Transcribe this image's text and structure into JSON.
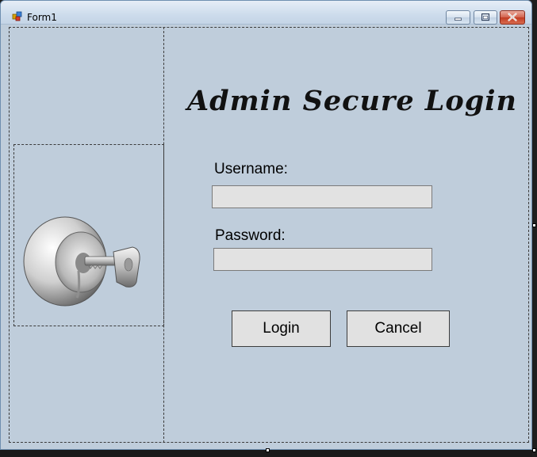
{
  "window": {
    "title": "Form1",
    "icon": "winforms-form-icon",
    "caption_buttons": [
      "minimize-icon",
      "maximize-icon",
      "close-icon"
    ]
  },
  "form": {
    "heading": "Admin Secure Login",
    "username_label": "Username:",
    "username_value": "",
    "password_label": "Password:",
    "password_value": "",
    "login_label": "Login",
    "cancel_label": "Cancel",
    "image": "key-in-lock-icon"
  },
  "colors": {
    "form_background": "#bfcddb",
    "textbox_background": "#e2e2e2",
    "button_background": "#e1e1e1",
    "close_button": "#c13b22"
  }
}
